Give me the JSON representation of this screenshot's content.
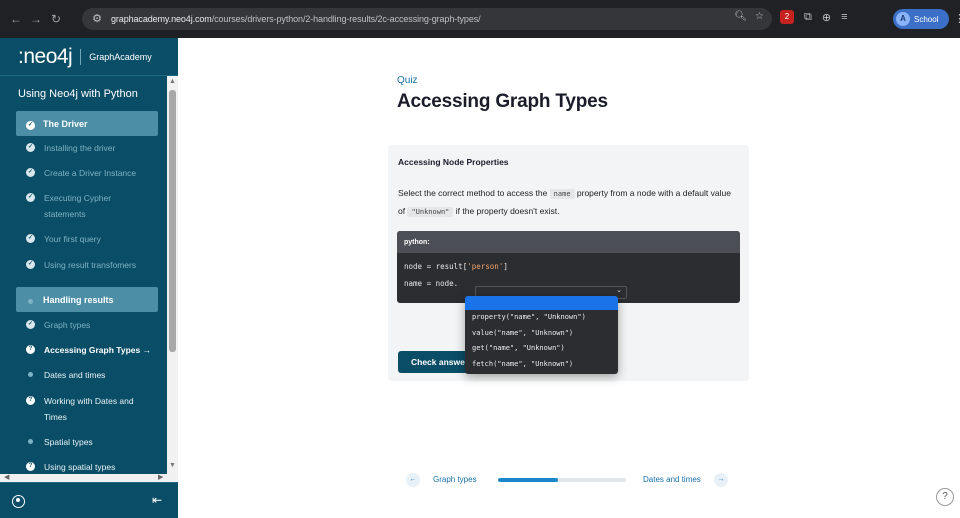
{
  "browser": {
    "url_host": "graphacademy.neo4j.com",
    "url_path": "/courses/drivers-python/2-handling-results/2c-accessing-graph-types/",
    "profile_label": "School",
    "profile_initial": "A",
    "ext_badge": "2"
  },
  "sidebar": {
    "logo": ":neo4j",
    "logo_sub": "GraphAcademy",
    "course_title": "Using Neo4j with Python",
    "modules": [
      {
        "label": "The Driver"
      },
      {
        "label": "Handling results"
      }
    ],
    "lessons": [
      {
        "label": "Installing the driver"
      },
      {
        "label": "Create a Driver Instance"
      },
      {
        "label": "Executing Cypher statements"
      },
      {
        "label": "Your first query"
      },
      {
        "label": "Using result transfomers"
      },
      {
        "label": "Graph types"
      },
      {
        "label": "Accessing Graph Types  →"
      },
      {
        "label": "Dates and times"
      },
      {
        "label": "Working with Dates and Times"
      },
      {
        "label": "Spatial types"
      },
      {
        "label": "Using spatial types"
      }
    ]
  },
  "quiz": {
    "kicker": "Quiz",
    "title": "Accessing Graph Types",
    "question_title": "Accessing Node Properties",
    "q_text_1": "Select the correct method to access the ",
    "q_code_1": "name",
    "q_text_2": " property from a node with a default value of ",
    "q_code_2": "\"Unknown\"",
    "q_text_3": " if the property doesn't exist.",
    "code_lang": "python:",
    "code_line1_a": "node = result[",
    "code_line1_str": "'person'",
    "code_line1_b": "]",
    "code_line2": "name = node.",
    "check_button": "Check answer",
    "options": [
      "property(\"name\", \"Unknown\")",
      "value(\"name\", \"Unknown\")",
      "get(\"name\", \"Unknown\")",
      "fetch(\"name\", \"Unknown\")"
    ]
  },
  "nav": {
    "prev_label": "Graph types",
    "next_label": "Dates and times",
    "progress": 0.47
  },
  "colors": {
    "sidebar": "#0a4d66",
    "accent": "#1670a8",
    "selected": "#1a73e8"
  }
}
